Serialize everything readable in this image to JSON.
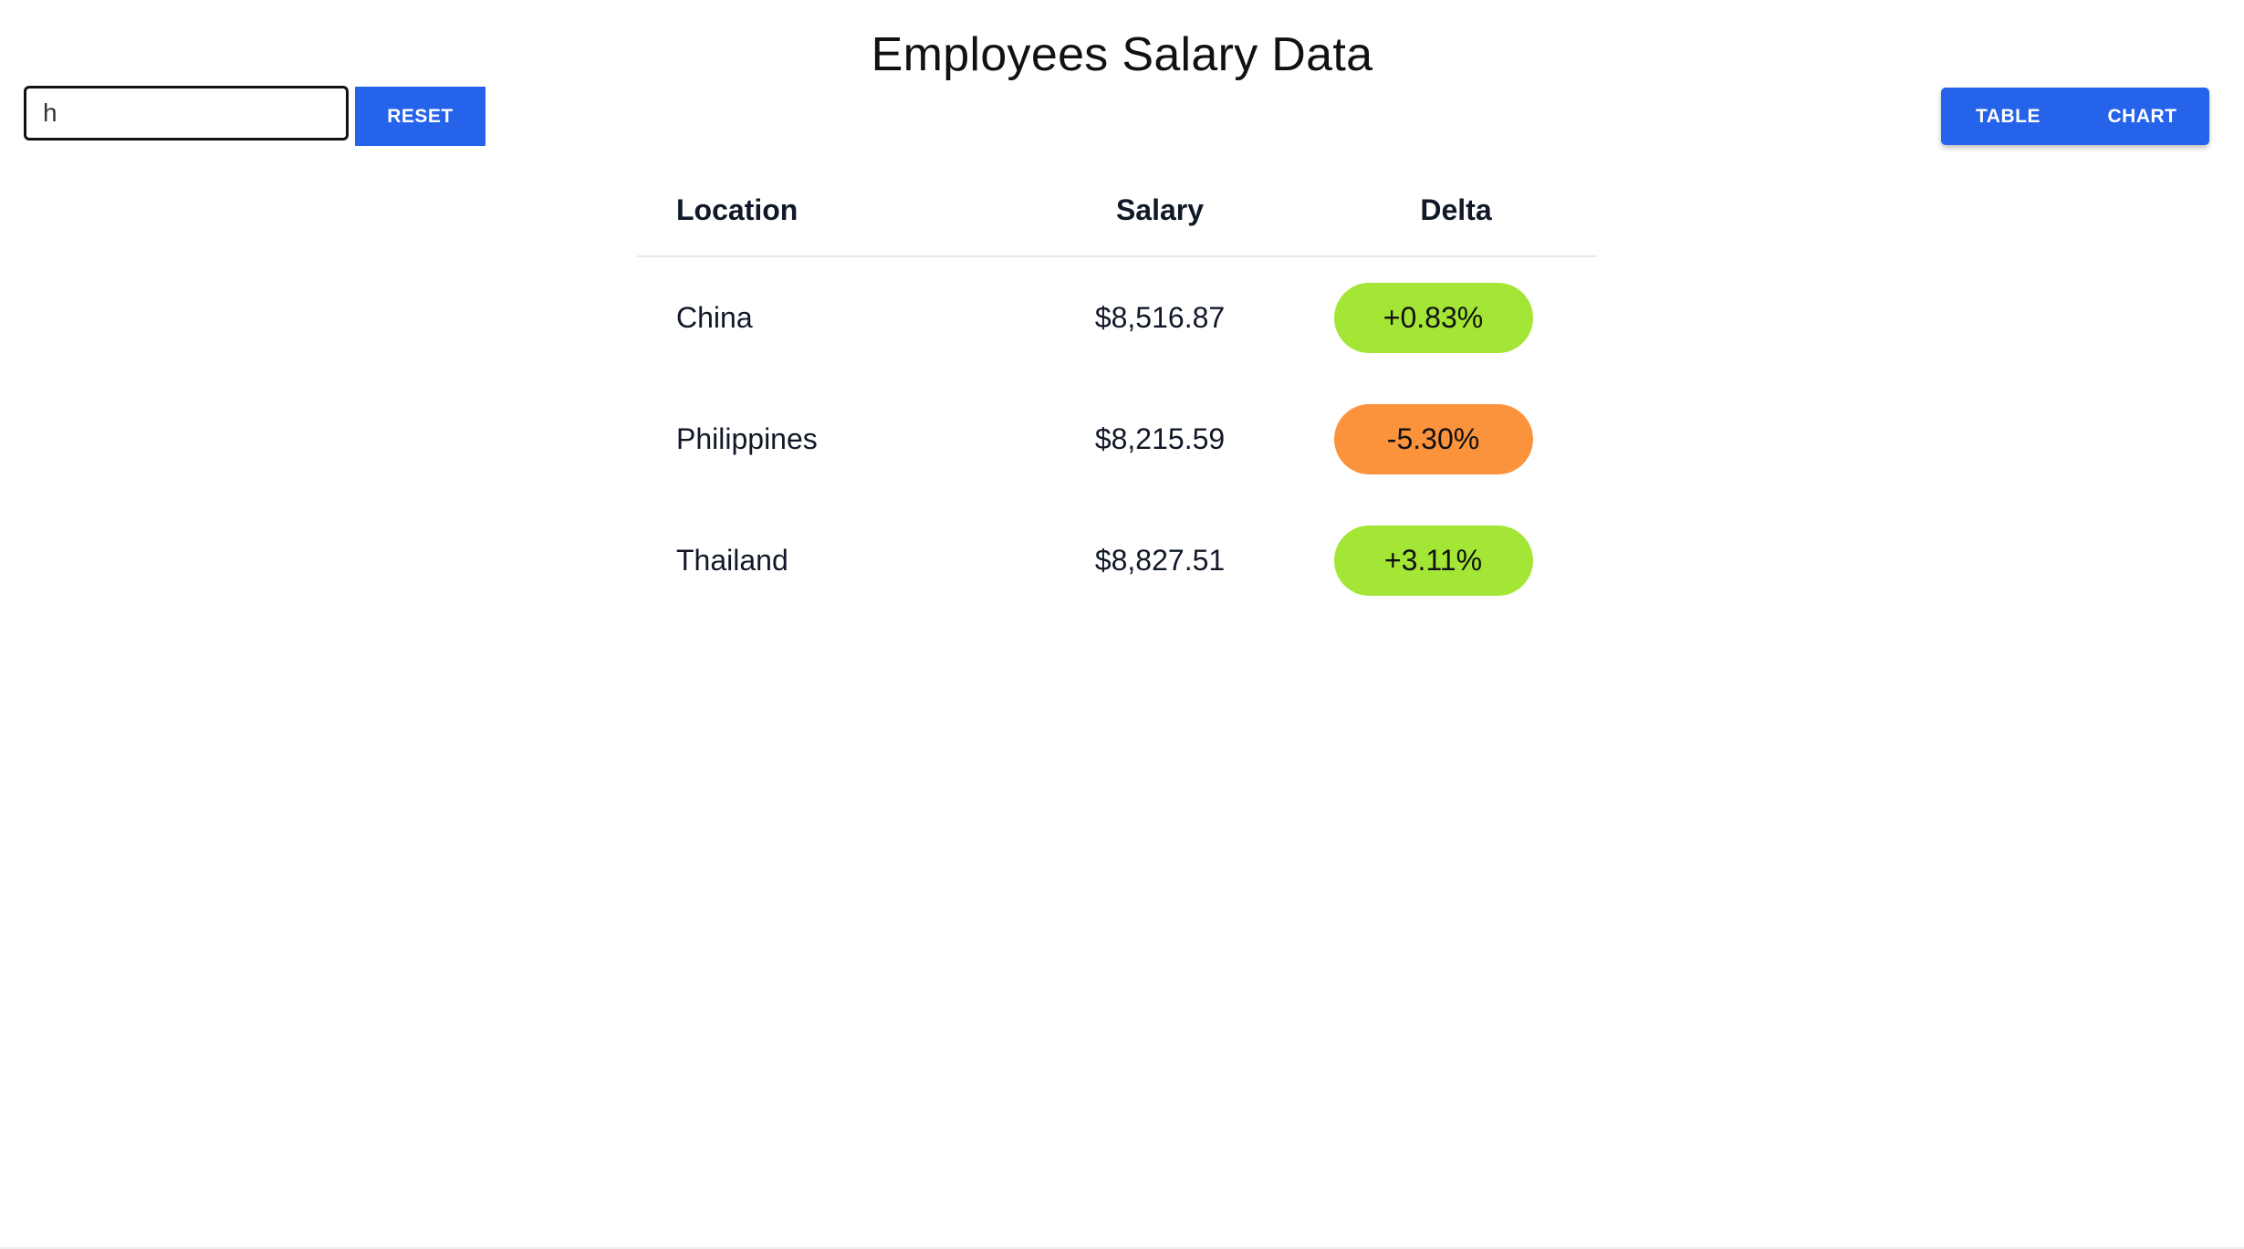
{
  "page": {
    "title": "Employees Salary Data"
  },
  "search": {
    "value": "h"
  },
  "reset_button": {
    "label": "RESET"
  },
  "view_toggle": {
    "table_label": "TABLE",
    "chart_label": "CHART"
  },
  "table": {
    "headers": {
      "location": "Location",
      "salary": "Salary",
      "delta": "Delta"
    },
    "rows": [
      {
        "location": "China",
        "salary": "$8,516.87",
        "delta": "+0.83%",
        "delta_color": "#a3e635"
      },
      {
        "location": "Philippines",
        "salary": "$8,215.59",
        "delta": "-5.30%",
        "delta_color": "#fb923c"
      },
      {
        "location": "Thailand",
        "salary": "$8,827.51",
        "delta": "+3.11%",
        "delta_color": "#a3e635"
      }
    ]
  },
  "colors": {
    "accent": "#2563eb",
    "positive": "#a3e635",
    "negative": "#fb923c"
  }
}
